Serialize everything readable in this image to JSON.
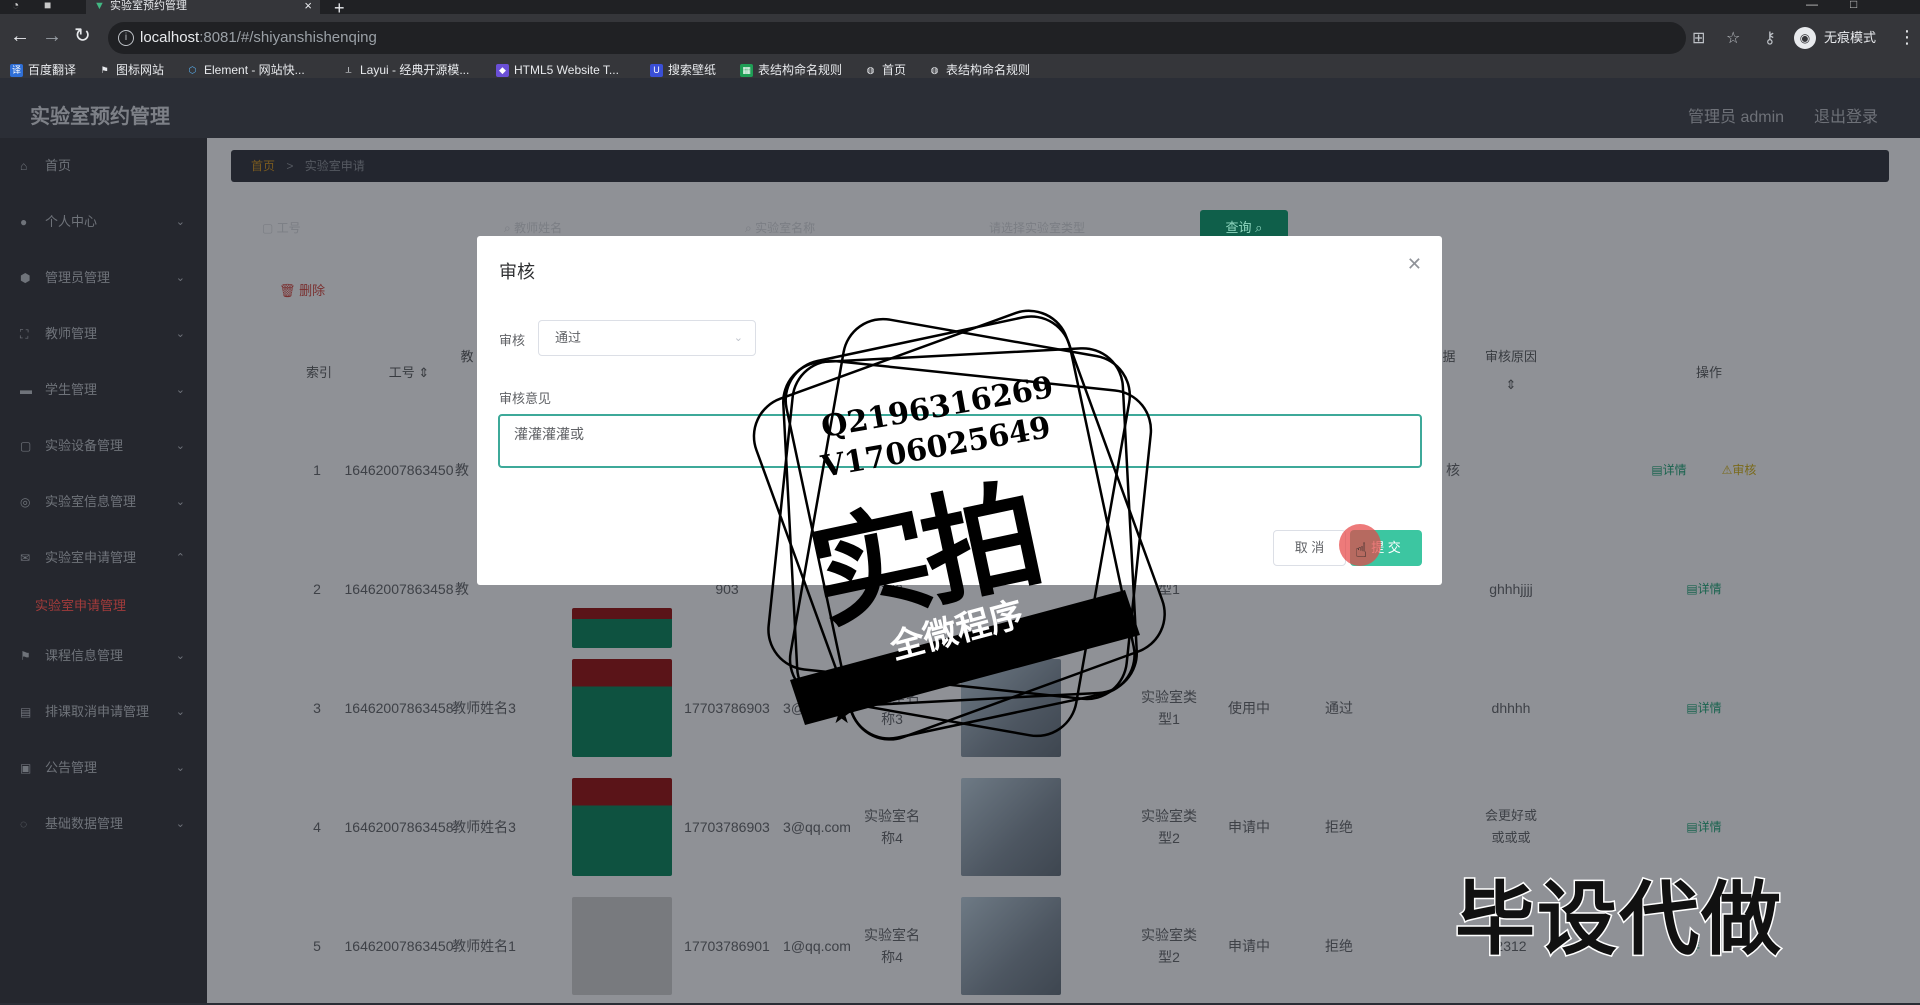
{
  "browser": {
    "tab_title": "实验室预约管理",
    "url_host": "localhost",
    "url_path": ":8081/#/shiyanshishenqing",
    "incognito_label": "无痕模式",
    "bookmarks": [
      "百度翻译",
      "图标网站",
      "Element - 网站快...",
      "Layui - 经典开源模...",
      "HTML5 Website T...",
      "搜索壁纸",
      "表结构命名规则",
      "首页",
      "表结构命名规则"
    ]
  },
  "header": {
    "title": "实验室预约管理",
    "user": "管理员 admin",
    "logout": "退出登录"
  },
  "sidebar": {
    "items": [
      "首页",
      "个人中心",
      "管理员管理",
      "教师管理",
      "学生管理",
      "实验设备管理",
      "实验室信息管理",
      "实验室申请管理",
      "课程信息管理",
      "排课取消申请管理",
      "公告管理",
      "基础数据管理"
    ],
    "active_sub": "实验室申请管理"
  },
  "breadcrumb": {
    "home": "首页",
    "sep": ">",
    "current": "实验室申请"
  },
  "filters": {
    "f1": "工号",
    "f2": "教师姓名",
    "f3": "实验室名称",
    "f4": "请选择实验室类型",
    "query": "查询"
  },
  "actions": {
    "delete": "删除"
  },
  "table": {
    "headers": {
      "index": "索引",
      "gonghao": "工号",
      "teacher": "教",
      "status": "据",
      "reason": "审核原因",
      "ops": "操作"
    },
    "rows": [
      {
        "idx": "1",
        "id": "16462007863450",
        "name": "教",
        "phone": "",
        "email": "",
        "lab": "",
        "type": "",
        "use": "",
        "audit": "核",
        "reason": "",
        "ops1": "详情",
        "ops2": "审核"
      },
      {
        "idx": "2",
        "id": "16462007863458",
        "name": "教",
        "phone": "903",
        "email": "",
        "lab": "称2",
        "type": "型1",
        "use": "",
        "audit": "",
        "reason": "ghhhjjjj",
        "ops1": "详情",
        "ops2": ""
      },
      {
        "idx": "3",
        "id": "16462007863458",
        "name": "教师姓名3",
        "phone": "17703786903",
        "email": "3@qq.com",
        "lab": "实验室名称3",
        "type": "实验室类型1",
        "use": "使用中",
        "audit": "通过",
        "reason": "dhhhh",
        "ops1": "详情",
        "ops2": ""
      },
      {
        "idx": "4",
        "id": "16462007863458",
        "name": "教师姓名3",
        "phone": "17703786903",
        "email": "3@qq.com",
        "lab": "实验室名称4",
        "type": "实验室类型2",
        "use": "申请中",
        "audit": "拒绝",
        "reason": "会更好或或或或",
        "ops1": "详情",
        "ops2": ""
      },
      {
        "idx": "5",
        "id": "16462007863450",
        "name": "教师姓名1",
        "phone": "17703786901",
        "email": "1@qq.com",
        "lab": "实验室名称4",
        "type": "实验室类型2",
        "use": "申请中",
        "audit": "拒绝",
        "reason": "2312",
        "ops1": "详",
        "ops2": ""
      }
    ]
  },
  "modal": {
    "title": "审核",
    "audit_label": "审核",
    "audit_value": "通过",
    "opinion_label": "审核意见",
    "opinion_value": "灌灌灌灌或",
    "cancel": "取 消",
    "submit": "提 交"
  },
  "watermark": {
    "line1": "Q2196316269",
    "line2": "V1706025649",
    "big": "实拍",
    "ribbon": "全微程序",
    "bottom": "毕设代做"
  }
}
